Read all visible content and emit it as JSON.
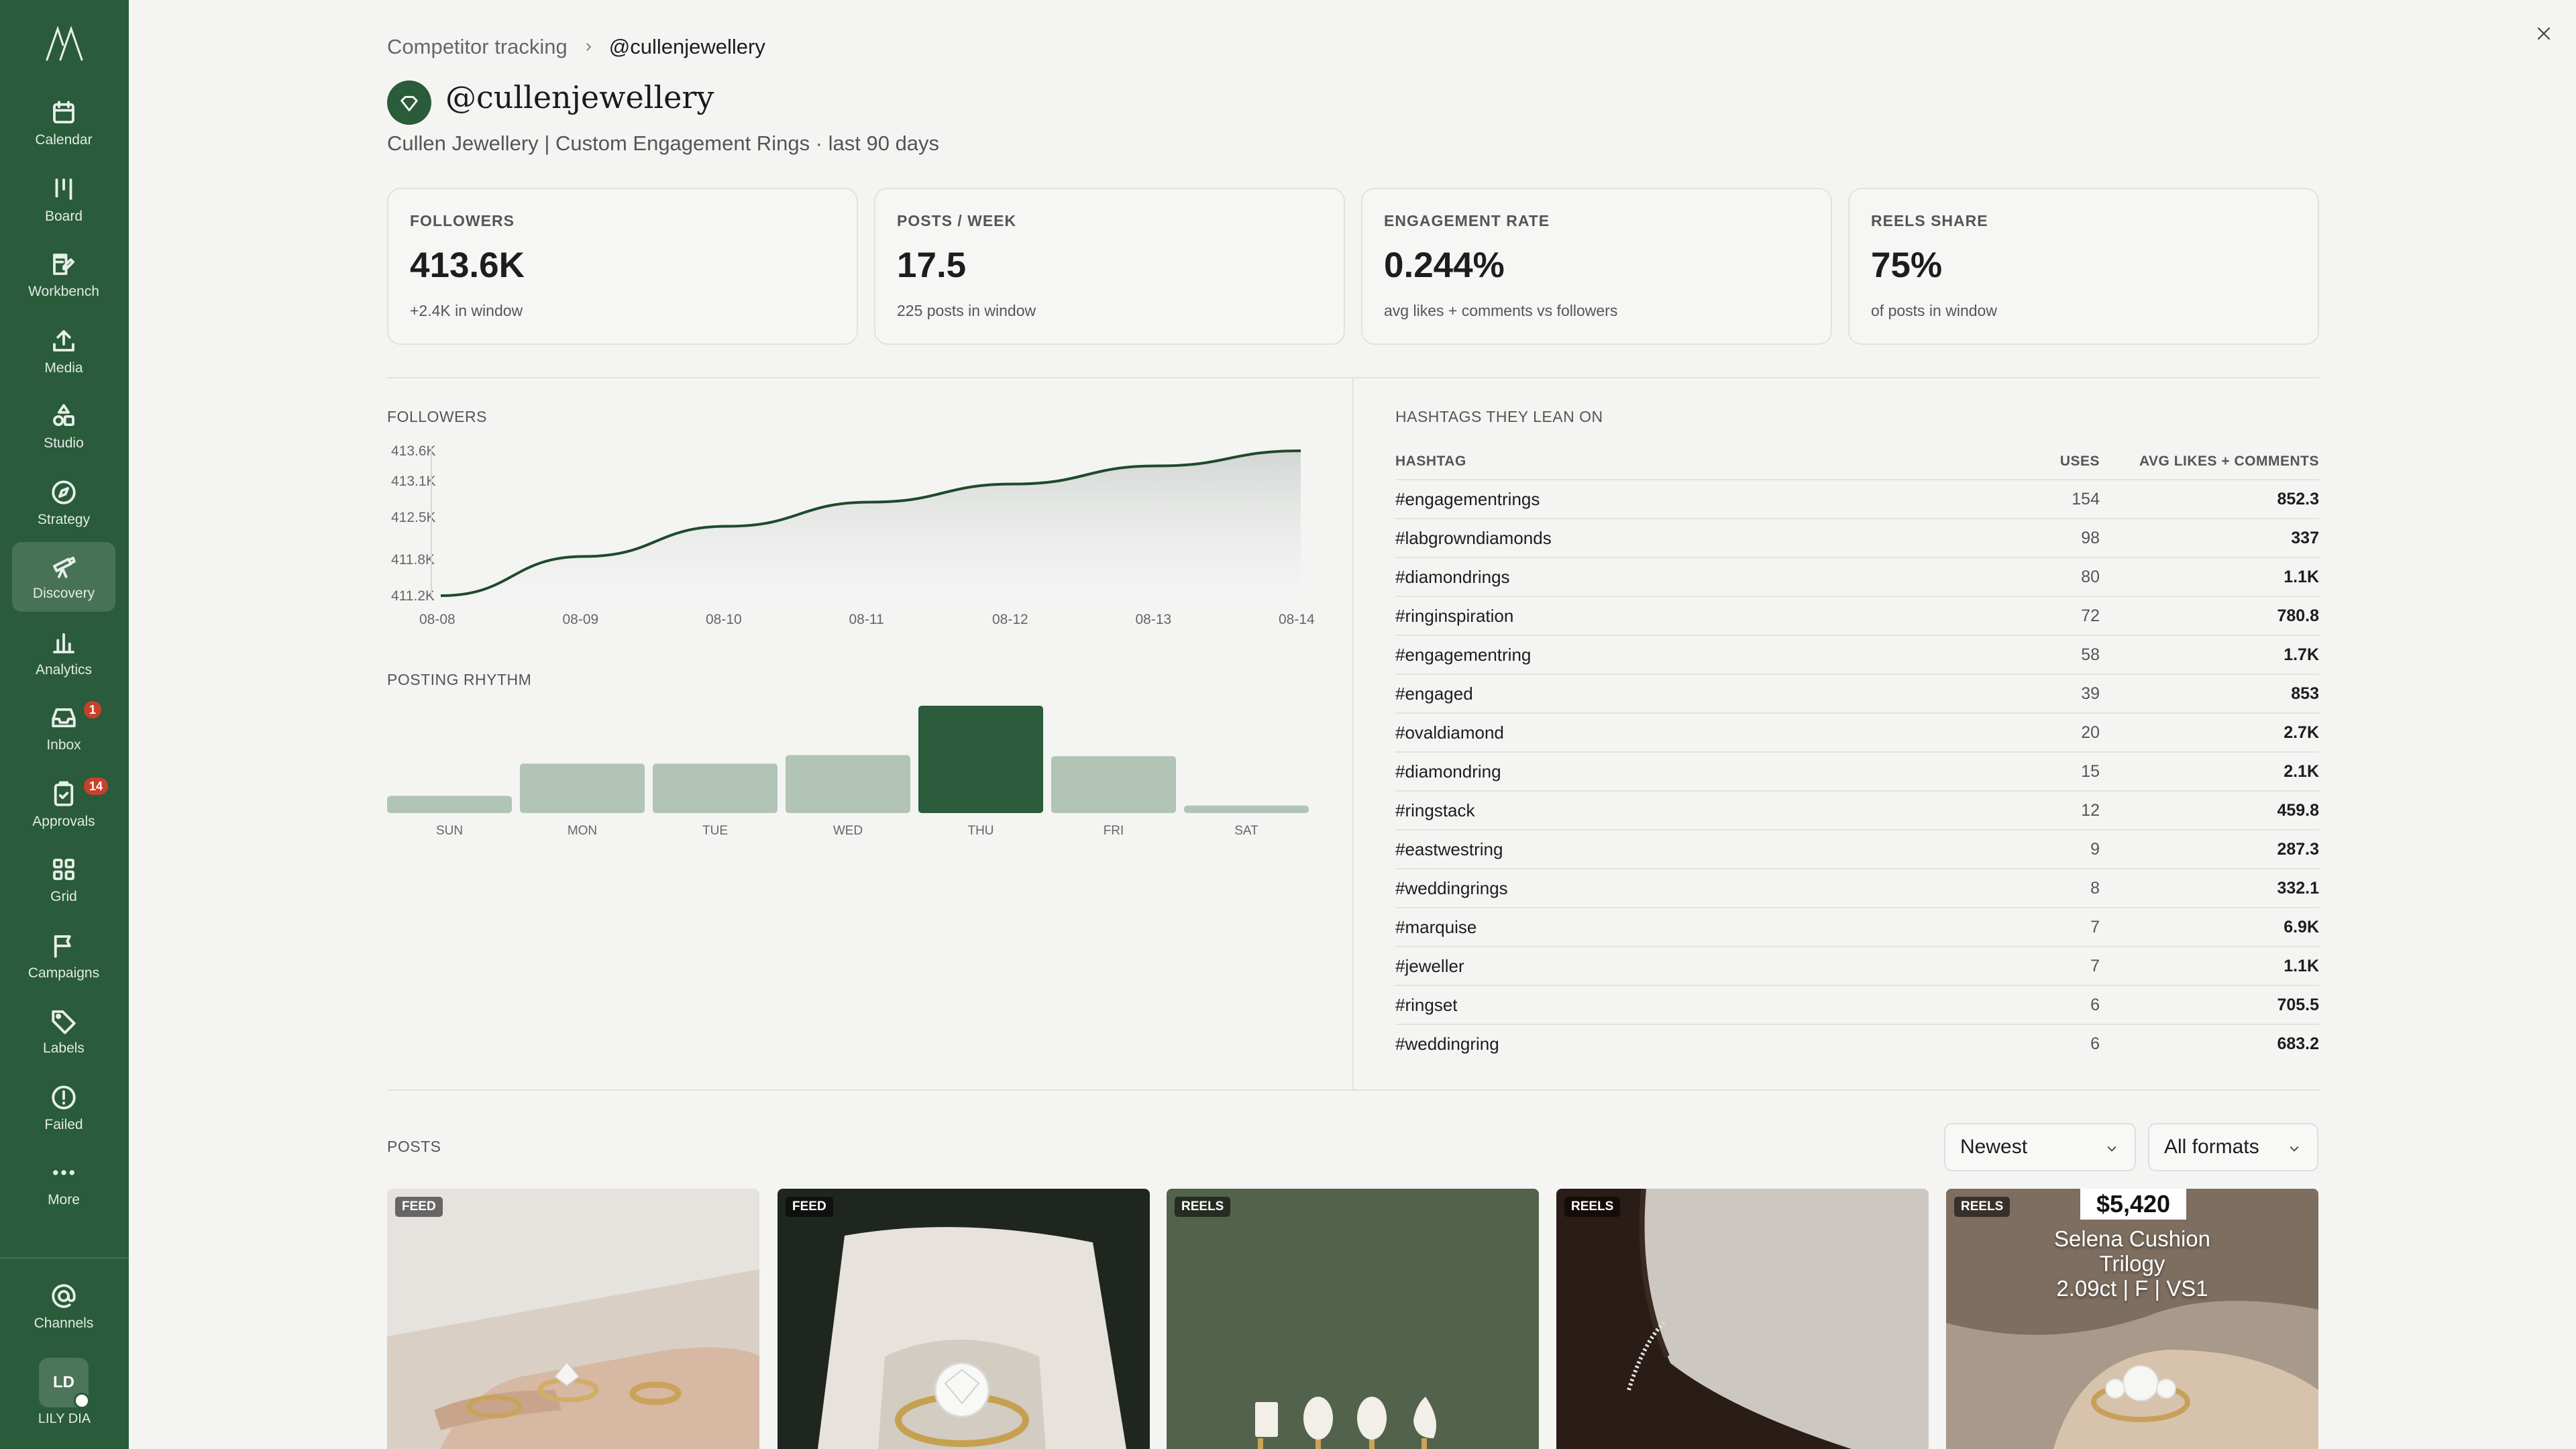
{
  "sidebar": {
    "items": [
      {
        "label": "Calendar",
        "icon": "calendar-icon"
      },
      {
        "label": "Board",
        "icon": "board-icon"
      },
      {
        "label": "Workbench",
        "icon": "workbench-icon"
      },
      {
        "label": "Media",
        "icon": "upload-icon"
      },
      {
        "label": "Studio",
        "icon": "studio-icon"
      },
      {
        "label": "Strategy",
        "icon": "compass-icon"
      },
      {
        "label": "Discovery",
        "icon": "telescope-icon"
      },
      {
        "label": "Analytics",
        "icon": "bar-chart-icon"
      },
      {
        "label": "Inbox",
        "icon": "inbox-icon",
        "badge": "1"
      },
      {
        "label": "Approvals",
        "icon": "clipboard-check-icon",
        "badge": "14"
      },
      {
        "label": "Grid",
        "icon": "grid-icon"
      },
      {
        "label": "Campaigns",
        "icon": "flag-icon"
      },
      {
        "label": "Labels",
        "icon": "tag-icon"
      },
      {
        "label": "Failed",
        "icon": "alert-circle-icon"
      },
      {
        "label": "More",
        "icon": "more-icon"
      },
      {
        "label": "Channels",
        "icon": "at-sign-icon"
      }
    ],
    "active": "Discovery",
    "user": {
      "initials": "LD",
      "name": "LILY DIA"
    }
  },
  "breadcrumb": {
    "parent": "Competitor tracking",
    "current": "@cullenjewellery"
  },
  "profile": {
    "handle": "@cullenjewellery",
    "subtitle": "Cullen Jewellery | Custom Engagement Rings · last 90 days"
  },
  "stats": [
    {
      "label": "FOLLOWERS",
      "value": "413.6K",
      "note": "+2.4K in window"
    },
    {
      "label": "POSTS / WEEK",
      "value": "17.5",
      "note": "225 posts in window"
    },
    {
      "label": "ENGAGEMENT RATE",
      "value": "0.244%",
      "note": "avg likes + comments vs followers"
    },
    {
      "label": "REELS SHARE",
      "value": "75%",
      "note": "of posts in window"
    }
  ],
  "followers_title": "FOLLOWERS",
  "rhythm_title": "POSTING RHYTHM",
  "chart_data": [
    {
      "type": "area",
      "title": "FOLLOWERS",
      "x": [
        "08-08",
        "08-09",
        "08-10",
        "08-11",
        "08-12",
        "08-13",
        "08-14"
      ],
      "y_ticks": [
        "413.6K",
        "413.1K",
        "412.5K",
        "411.8K",
        "411.2K"
      ],
      "values": [
        411.2,
        411.85,
        412.35,
        412.75,
        413.05,
        413.35,
        413.6
      ],
      "ylim": [
        411.2,
        413.6
      ],
      "color": "#1f4a2c"
    },
    {
      "type": "bar",
      "title": "POSTING RHYTHM",
      "categories": [
        "SUN",
        "MON",
        "TUE",
        "WED",
        "THU",
        "FRI",
        "SAT"
      ],
      "values": [
        0.16,
        0.46,
        0.46,
        0.54,
        1.0,
        0.53,
        0.07
      ],
      "highlight": "THU",
      "colors": {
        "normal": "#b1c4b6",
        "highlight": "#2c5c3b"
      }
    }
  ],
  "hashtags": {
    "title": "HASHTAGS THEY LEAN ON",
    "columns": [
      "HASHTAG",
      "USES",
      "AVG LIKES + COMMENTS"
    ],
    "rows": [
      [
        "#engagementrings",
        "154",
        "852.3"
      ],
      [
        "#labgrowndiamonds",
        "98",
        "337"
      ],
      [
        "#diamondrings",
        "80",
        "1.1K"
      ],
      [
        "#ringinspiration",
        "72",
        "780.8"
      ],
      [
        "#engagementring",
        "58",
        "1.7K"
      ],
      [
        "#engaged",
        "39",
        "853"
      ],
      [
        "#ovaldiamond",
        "20",
        "2.7K"
      ],
      [
        "#diamondring",
        "15",
        "2.1K"
      ],
      [
        "#ringstack",
        "12",
        "459.8"
      ],
      [
        "#eastwestring",
        "9",
        "287.3"
      ],
      [
        "#weddingrings",
        "8",
        "332.1"
      ],
      [
        "#marquise",
        "7",
        "6.9K"
      ],
      [
        "#jeweller",
        "7",
        "1.1K"
      ],
      [
        "#ringset",
        "6",
        "705.5"
      ],
      [
        "#weddingring",
        "6",
        "683.2"
      ]
    ]
  },
  "posts": {
    "title": "POSTS",
    "sort": "Newest",
    "format": "All formats",
    "items": [
      {
        "type": "FEED"
      },
      {
        "type": "FEED"
      },
      {
        "type": "REELS"
      },
      {
        "type": "REELS"
      },
      {
        "type": "REELS",
        "price": "$5,420",
        "caption": "Selena Cushion\nTrilogy\n2.09ct | F | VS1"
      }
    ]
  }
}
